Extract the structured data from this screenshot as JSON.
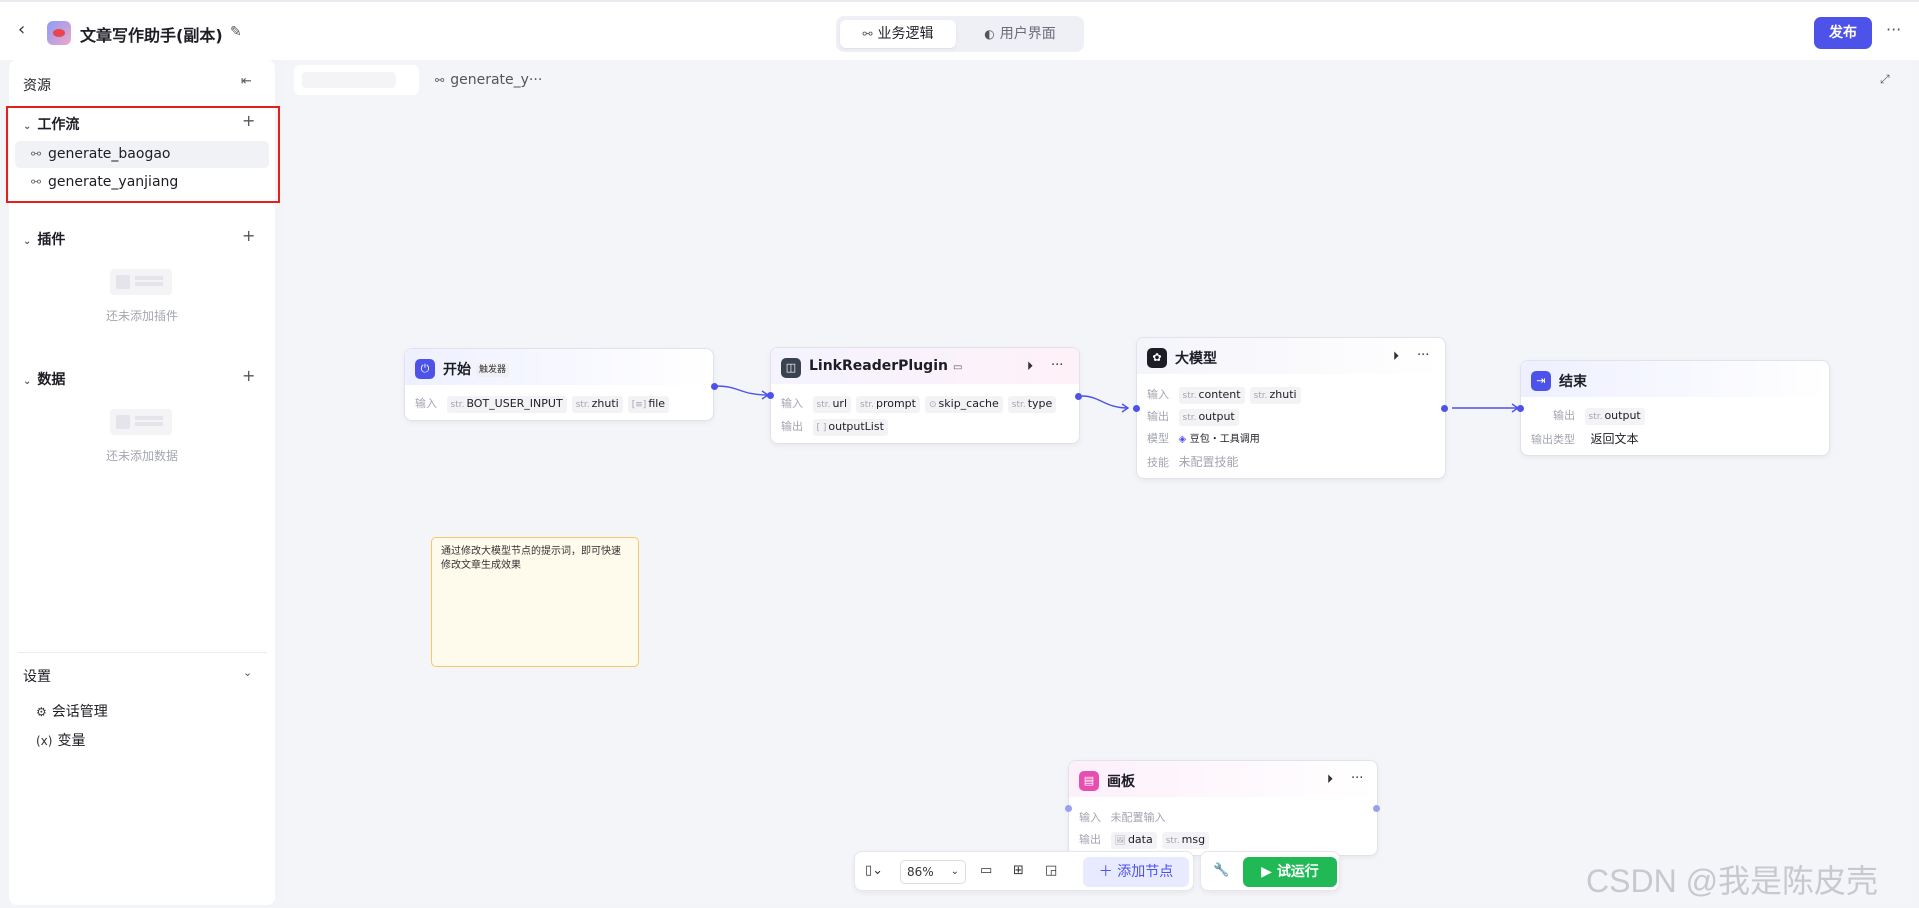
{
  "header": {
    "app_title": "文章写作助手(副本)",
    "tabs": [
      {
        "label": "业务逻辑",
        "active": true
      },
      {
        "label": "用户界面",
        "active": false
      }
    ],
    "publish_label": "发布",
    "more_glyph": "···"
  },
  "sidebar": {
    "title": "资源",
    "workflow": {
      "label": "工作流",
      "items": [
        {
          "label": "generate_baogao"
        },
        {
          "label": "generate_yanjiang"
        }
      ]
    },
    "plugin": {
      "label": "插件",
      "empty_text": "还未添加插件"
    },
    "data": {
      "label": "数据",
      "empty_text": "还未添加数据"
    },
    "settings": {
      "label": "设置",
      "items": [
        {
          "label": "会话管理",
          "icon": "chat-settings-icon"
        },
        {
          "label": "变量",
          "icon": "variable-icon",
          "glyph": "(x)"
        }
      ]
    }
  },
  "canvas": {
    "tab_label": "generate_y···",
    "nodes": {
      "start": {
        "title": "开始",
        "badge": "触发器",
        "input_label": "输入",
        "inputs": [
          {
            "type": "str.",
            "name": "BOT_USER_INPUT"
          },
          {
            "type": "str.",
            "name": "zhuti"
          },
          {
            "type": "[≡]",
            "name": "file"
          }
        ]
      },
      "plugin": {
        "title": "LinkReaderPlugin",
        "input_label": "输入",
        "output_label": "输出",
        "inputs": [
          {
            "type": "str.",
            "name": "url"
          },
          {
            "type": "str.",
            "name": "prompt"
          },
          {
            "type": "⊙",
            "name": "skip_cache"
          },
          {
            "type": "str.",
            "name": "type"
          }
        ],
        "outputs": [
          {
            "type": "[ ]",
            "name": "outputList"
          }
        ]
      },
      "llm": {
        "title": "大模型",
        "input_label": "输入",
        "output_label": "输出",
        "model_label": "模型",
        "skill_label": "技能",
        "inputs": [
          {
            "type": "str.",
            "name": "content"
          },
          {
            "type": "str.",
            "name": "zhuti"
          }
        ],
        "outputs": [
          {
            "type": "str.",
            "name": "output"
          }
        ],
        "model_value": "豆包・工具调用",
        "skill_value": "未配置技能"
      },
      "end": {
        "title": "结束",
        "output_label": "输出",
        "output_type_label": "输出类型",
        "outputs": [
          {
            "type": "str.",
            "name": "output"
          }
        ],
        "output_type_value": "返回文本"
      },
      "board": {
        "title": "画板",
        "input_label": "输入",
        "output_label": "输出",
        "input_value": "未配置输入",
        "outputs": [
          {
            "type": "🖼",
            "name": "data"
          },
          {
            "type": "str.",
            "name": "msg"
          }
        ]
      }
    },
    "note_text": "通过修改大模型节点的提示词，即可快速修改文章生成效果"
  },
  "toolbar": {
    "zoom": "86%",
    "add_node_label": "添加节点",
    "run_label": "试运行"
  },
  "watermark": "CSDN @我是陈皮壳",
  "colors": {
    "accent": "#4d53e8",
    "run_green": "#20b956",
    "highlight_red": "#e1221b"
  }
}
